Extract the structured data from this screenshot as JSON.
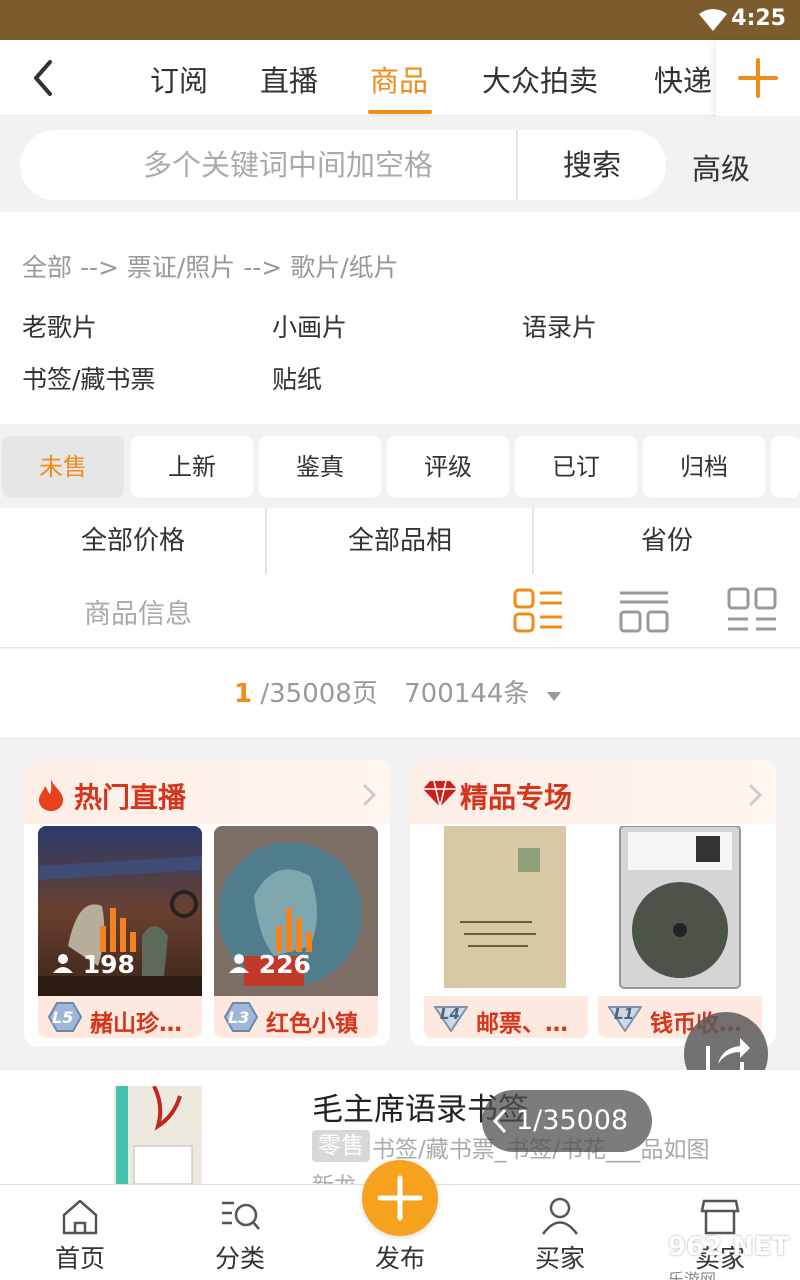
{
  "status": {
    "time": "4:25"
  },
  "nav": {
    "tabs": [
      {
        "label": "订阅"
      },
      {
        "label": "直播"
      },
      {
        "label": "商品"
      },
      {
        "label": "大众拍卖"
      },
      {
        "label": "快递"
      }
    ],
    "active_tab": "商品"
  },
  "search": {
    "placeholder": "多个关键词中间加空格",
    "button": "搜索",
    "advanced": "高级"
  },
  "category": {
    "breadcrumb": "全部 --> 票证/照片 --> 歌片/纸片",
    "items": [
      "老歌片",
      "小画片",
      "语录片",
      "书签/藏书票",
      "贴纸"
    ]
  },
  "filters": [
    "未售",
    "上新",
    "鉴真",
    "评级",
    "已订",
    "归档"
  ],
  "sorts": [
    "全部价格",
    "全部品相",
    "省份"
  ],
  "view": {
    "label": "商品信息"
  },
  "pagination": {
    "current": "1",
    "total": "/35008页",
    "count": "700144条"
  },
  "promos": [
    {
      "title": "热门直播",
      "tiles": [
        {
          "viewers": "198",
          "level": "L5",
          "name": "赭山珍…"
        },
        {
          "viewers": "226",
          "level": "L3",
          "name": "红色小镇"
        }
      ]
    },
    {
      "title": "精品专场",
      "tiles": [
        {
          "level": "L4",
          "name": "邮票、…"
        },
        {
          "level": "L1",
          "name": "钱币收…"
        }
      ]
    }
  ],
  "list_item": {
    "title": "毛主席语录书签",
    "tag": "零售",
    "category": "书签/藏书票_书签/书花___品如图",
    "sub": "新龙"
  },
  "floating_pager": "1/35008",
  "bottom_nav": [
    "首页",
    "分类",
    "发布",
    "买家",
    "卖家"
  ],
  "watermark": {
    "main": "962.NET",
    "sub": "乐游网"
  },
  "colors": {
    "accent": "#ef8c1a",
    "status_bar": "#7c5c2c",
    "promo_red": "#d4351c",
    "publish": "#f6a21f"
  }
}
